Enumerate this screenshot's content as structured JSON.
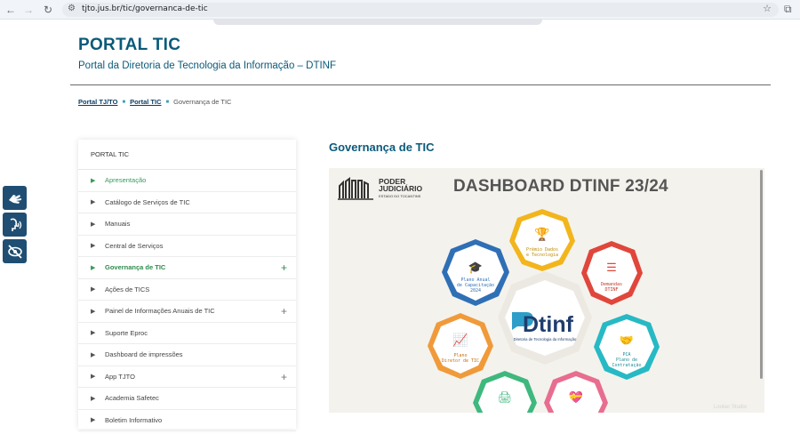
{
  "browser": {
    "url": "tjto.jus.br/tic/governanca-de-tic"
  },
  "header": {
    "title": "PORTAL TIC",
    "subtitle": "Portal da Diretoria de Tecnologia da Informação – DTINF"
  },
  "breadcrumb": {
    "items": [
      "Portal TJ/TO",
      "Portal TIC"
    ],
    "current": "Governança de TIC"
  },
  "sidebar": {
    "heading": "PORTAL TIC",
    "items": [
      {
        "label": "Apresentação"
      },
      {
        "label": "Catálogo de Serviços de TIC"
      },
      {
        "label": "Manuais"
      },
      {
        "label": "Central de Serviços"
      },
      {
        "label": "Governança de TIC"
      },
      {
        "label": "Ações de TICS"
      },
      {
        "label": "Painel de Informações Anuais de TIC"
      },
      {
        "label": "Suporte Eproc"
      },
      {
        "label": "Dashboard de impressões"
      },
      {
        "label": "App TJTO"
      },
      {
        "label": "Academia Safetec"
      },
      {
        "label": "Boletim Informativo"
      }
    ]
  },
  "content": {
    "title": "Governança de TIC"
  },
  "dashboard": {
    "logo_main_1": "PODER",
    "logo_main_2": "JUDICIÁRIO",
    "logo_small": "ESTADO DO TOCANTINS",
    "title": "DASHBOARD DTINF 23/24",
    "center_logo": "Dtinf",
    "center_caption": "Diretoria de Tecnologia da Informação",
    "nodes": {
      "premio": [
        "Prêmio Dados",
        "e Tecnologia"
      ],
      "demandas": [
        "Demandas",
        "DTINF"
      ],
      "pca": [
        "PCA",
        "Plano de",
        "Contratação"
      ],
      "plano_anual": [
        "Plano Anual",
        "de Capacitação",
        "2024"
      ],
      "pdtic": [
        "Plano",
        "Diretor de TIC"
      ]
    },
    "watermark": "Looker Studio"
  },
  "colors": {
    "brand": "#0b5a7a",
    "active": "#2e8b4e",
    "accessibility": "#1f4e72",
    "yellow": "#f2b51c",
    "red": "#e0463b",
    "teal": "#27b9c4",
    "blue": "#2f6fb5",
    "orange": "#f09a3a",
    "green": "#3fb87e",
    "pink": "#e86d8f"
  }
}
